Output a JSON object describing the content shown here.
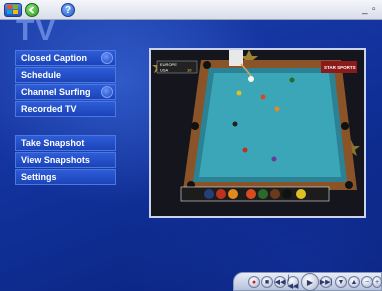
{
  "app": {
    "title": "TV"
  },
  "topbar": {
    "home_icon": "windows-flag-icon",
    "back_icon": "back-arrow-icon",
    "help_label": "?",
    "minimize_label": "_",
    "restore_label": "▫"
  },
  "menu_main": [
    {
      "label": "Closed Caption",
      "has_toggle": true
    },
    {
      "label": "Schedule",
      "has_toggle": false
    },
    {
      "label": "Channel Surfing",
      "has_toggle": true
    },
    {
      "label": "Recorded TV",
      "has_toggle": false
    }
  ],
  "menu_snapshots": [
    {
      "label": "Take Snapshot"
    },
    {
      "label": "View Snapshots"
    },
    {
      "label": "Settings"
    }
  ],
  "video": {
    "scoreboard_top": "EUROPE",
    "scoreboard_bottom": "USA",
    "score": "10",
    "channel_logo": "STAR SPORTS"
  },
  "transport": {
    "record": "●",
    "stop": "■",
    "rewind": "◀◀",
    "skip_back": "|◀◀",
    "play": "▶",
    "skip_forward": "▶▶|",
    "channel_down": "▼",
    "channel_up": "▲",
    "volume_down": "−",
    "volume_up": "+"
  },
  "colors": {
    "background": "#1434a0",
    "menu_item": "#2451c8",
    "felt": "#3aa6b8",
    "wood": "#8a5428"
  }
}
